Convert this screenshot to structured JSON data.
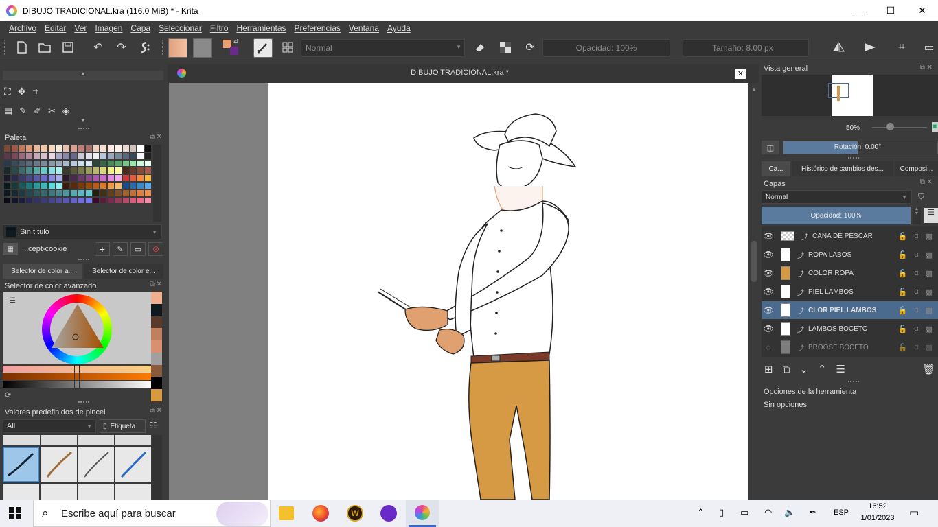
{
  "window": {
    "title": "DIBUJO TRADICIONAL.kra (116.0 MiB)  * - Krita",
    "minimize": "—",
    "maximize": "☐",
    "close": "✕"
  },
  "menu": [
    "Archivo",
    "Editar",
    "Ver",
    "Imagen",
    "Capa",
    "Seleccionar",
    "Filtro",
    "Herramientas",
    "Preferencias",
    "Ventana",
    "Ayuda"
  ],
  "toolbar": {
    "blend_mode": "Normal",
    "opacity": "Opacidad: 100%",
    "size": "Tamaño: 8.00 px"
  },
  "left_dock": {
    "palette_title": "Paleta",
    "palette_name": "Sin título",
    "palette_resource": "...cept-cookie",
    "selector_tabs": [
      "Selector de color a...",
      "Selector de color e..."
    ],
    "advanced_selector_title": "Selector de color avanzado",
    "brush_presets_title": "Valores predefinidos de pincel",
    "brush_filter": "All",
    "brush_tag": "Etiqueta"
  },
  "document": {
    "tab_title": "DIBUJO TRADICIONAL.kra *"
  },
  "right_dock": {
    "overview_title": "Vista general",
    "zoom": "50%",
    "rotation": "Rotación: 0.00°",
    "tabs": [
      "Ca...",
      "Histórico de cambios des...",
      "Composi..."
    ],
    "layers_title": "Capas",
    "layer_blend": "Normal",
    "layer_opacity": "Opacidad:  100%",
    "layers": [
      {
        "name": "CAÑA DE PESCAR",
        "selected": false
      },
      {
        "name": "ROPA LABOS",
        "selected": false
      },
      {
        "name": "COLOR ROPA",
        "selected": false
      },
      {
        "name": "PIEL LAMBOS",
        "selected": false
      },
      {
        "name": "CLOR PIEL LAMBOS",
        "selected": true
      },
      {
        "name": "LAMBOS BOCETO",
        "selected": false
      },
      {
        "name": "BROOSE BOCETO",
        "selected": false
      }
    ],
    "tool_options_title": "Opciones de la herramienta",
    "tool_options_empty": "Sin opciones"
  },
  "taskbar": {
    "search_placeholder": "Escribe aquí para buscar",
    "language": "ESP",
    "time": "16:52",
    "date": "1/01/2023"
  }
}
